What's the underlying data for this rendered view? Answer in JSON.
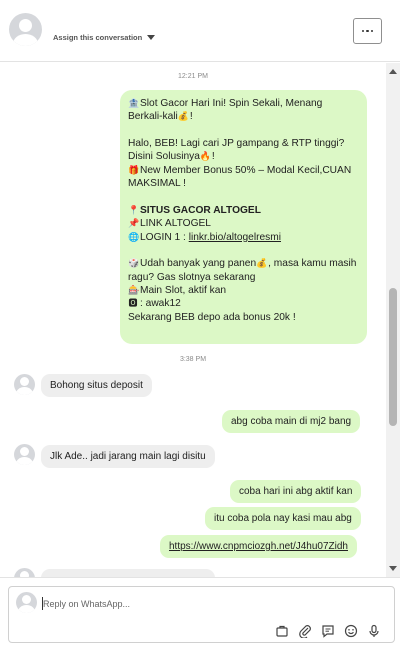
{
  "header": {
    "assign_label": "Assign this conversation"
  },
  "messages": {
    "ts1": "12:21 PM",
    "promo": {
      "line1": "Slot Gacor Hari Ini! Spin Sekali, Menang Berkali-kali",
      "line1_end": "!",
      "line2": "Halo, BEB! Lagi cari JP gampang & RTP tinggi? Disini Solusinya",
      "line2_end": "!",
      "line3": "New Member Bonus 50% – Modal Kecil,CUAN MAKSIMAL !",
      "line4": "SITUS GACOR ALTOGEL",
      "line5": "LINK ALTOGEL",
      "line6_label": "LOGIN 1 : ",
      "line6_link": "linkr.bio/altogelresmi",
      "line7": "Udah banyak yang panen",
      "line7_end": ", masa kamu masih ragu? Gas slotnya sekarang",
      "line8": "Main Slot, aktif kan",
      "line9": ":  awak12",
      "line10": "Sekarang BEB depo ada bonus 20k !"
    },
    "ts2": "3:38 PM",
    "m1": "Bohong situs deposit",
    "m2": "abg coba main di mj2 bang",
    "m3": "Jlk Ade.. jadi jarang main lagi disitu",
    "m4": "coba hari ini abg aktif kan",
    "m5": "itu coba pola nay kasi mau abg",
    "m6": "https://www.cnpmciozgh.net/J4hu07Zidh"
  },
  "composer": {
    "placeholder": "Reply on WhatsApp..."
  },
  "icons": [
    "more-icon",
    "caret-down-icon",
    "template-icon",
    "attachment-icon",
    "quick-reply-icon",
    "emoji-icon",
    "microphone-icon"
  ],
  "colors": {
    "outgoing_bubble": "#dcf8c6",
    "incoming_bubble": "#eeeeee",
    "edge_accent": "#4caf50"
  }
}
